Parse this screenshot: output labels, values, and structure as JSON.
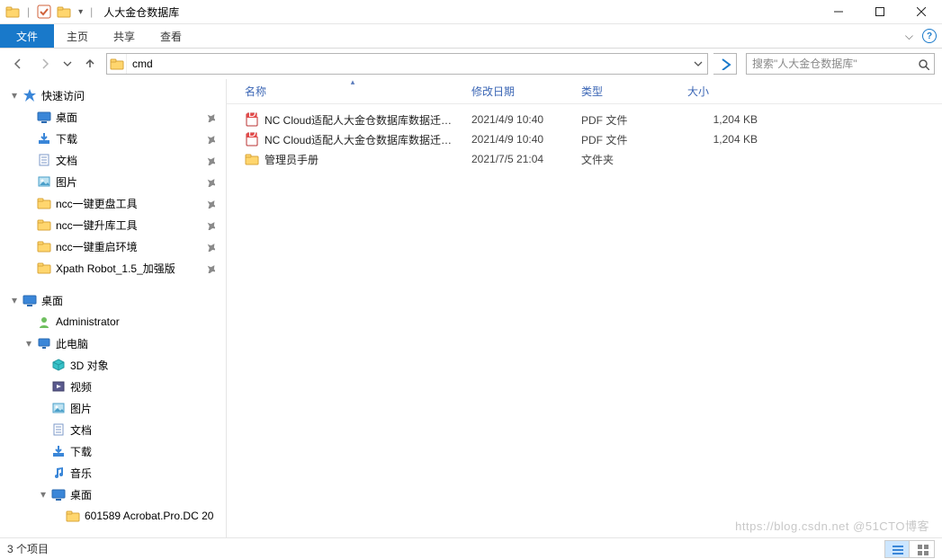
{
  "window": {
    "title": "人大金仓数据库"
  },
  "ribbon": {
    "file": "文件",
    "tabs": [
      "主页",
      "共享",
      "查看"
    ]
  },
  "address": {
    "value": "cmd"
  },
  "search": {
    "placeholder": "搜索\"人大金仓数据库\""
  },
  "sidebar": {
    "quick_access": "快速访问",
    "quick_items": [
      {
        "label": "桌面",
        "icon": "desktop",
        "pinned": true
      },
      {
        "label": "下载",
        "icon": "downloads",
        "pinned": true
      },
      {
        "label": "文档",
        "icon": "documents",
        "pinned": true
      },
      {
        "label": "图片",
        "icon": "pictures",
        "pinned": true
      },
      {
        "label": "ncc一键更盘工具",
        "icon": "folder",
        "pinned": true
      },
      {
        "label": "ncc一键升库工具",
        "icon": "folder",
        "pinned": true
      },
      {
        "label": "ncc一键重启环境",
        "icon": "folder",
        "pinned": true
      },
      {
        "label": "Xpath Robot_1.5_加强版",
        "icon": "folder",
        "pinned": true
      }
    ],
    "desktop_root": "桌面",
    "desktop_items": [
      {
        "label": "Administrator",
        "icon": "user"
      },
      {
        "label": "此电脑",
        "icon": "pc",
        "expandable": true,
        "children": [
          {
            "label": "3D 对象",
            "icon": "objects3d"
          },
          {
            "label": "视频",
            "icon": "videos"
          },
          {
            "label": "图片",
            "icon": "pictures"
          },
          {
            "label": "文档",
            "icon": "documents"
          },
          {
            "label": "下载",
            "icon": "downloads"
          },
          {
            "label": "音乐",
            "icon": "music"
          },
          {
            "label": "桌面",
            "icon": "desktop",
            "expandable": true,
            "children": [
              {
                "label": "601589 Acrobat.Pro.DC 20",
                "icon": "folder"
              }
            ]
          }
        ]
      }
    ]
  },
  "columns": {
    "name": "名称",
    "date": "修改日期",
    "type": "类型",
    "size": "大小"
  },
  "files": [
    {
      "name": "NC Cloud适配人大金仓数据库数据迁移...",
      "date": "2021/4/9 10:40",
      "type": "PDF 文件",
      "size": "1,204 KB",
      "icon": "pdf"
    },
    {
      "name": "NC Cloud适配人大金仓数据库数据迁移...",
      "date": "2021/4/9 10:40",
      "type": "PDF 文件",
      "size": "1,204 KB",
      "icon": "pdf"
    },
    {
      "name": "管理员手册",
      "date": "2021/7/5 21:04",
      "type": "文件夹",
      "size": "",
      "icon": "folder"
    }
  ],
  "status": {
    "count_label": "3 个项目"
  },
  "watermark": "https://blog.csdn.net   @51CTO博客"
}
